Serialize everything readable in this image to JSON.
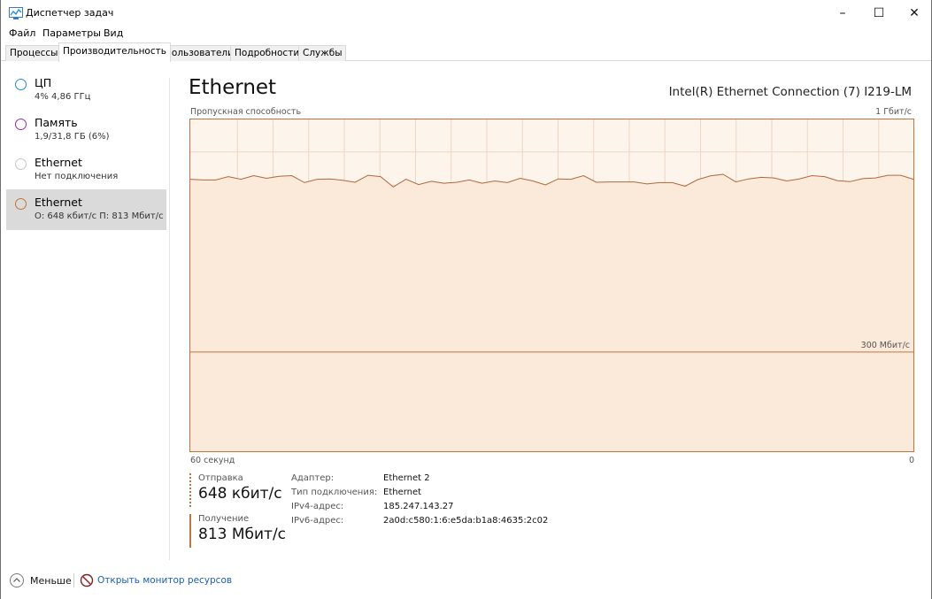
{
  "window": {
    "title": "Диспетчер задач",
    "buttons": {
      "minimize": "–",
      "maximize": "☐",
      "close": "✕"
    }
  },
  "menu": [
    "Файл",
    "Параметры",
    "Вид"
  ],
  "tabs": [
    {
      "label": "Процессы",
      "active": false
    },
    {
      "label": "Производительность",
      "active": true
    },
    {
      "label": "Пользователи",
      "active": false
    },
    {
      "label": "Подробности",
      "active": false
    },
    {
      "label": "Службы",
      "active": false
    }
  ],
  "sidebar": {
    "items": [
      {
        "name": "ЦП",
        "sub": "4% 4,86 ГГц",
        "color": "#1e8ad7",
        "selected": false
      },
      {
        "name": "Память",
        "sub": "1,9/31,8 ГБ (6%)",
        "color": "#9b2aa3",
        "selected": false
      },
      {
        "name": "Ethernet",
        "sub": "Нет подключения",
        "color": "#c8c8c8",
        "selected": false
      },
      {
        "name": "Ethernet",
        "sub": "О: 648 кбит/с П: 813 Мбит/с",
        "color": "#c1743d",
        "selected": true
      }
    ]
  },
  "main": {
    "title": "Ethernet",
    "adapter": "Intel(R) Ethernet Connection (7) I219-LM",
    "graph_label_left": "Пропускная способность",
    "graph_label_right": "1 Гбит/с",
    "scale_mark": "300 Мбит/с",
    "axis_left": "60 секунд",
    "axis_right": "0"
  },
  "stats": {
    "send_label": "Отправка",
    "send_value": "648 кбит/с",
    "recv_label": "Получение",
    "recv_value": "813 Мбит/с"
  },
  "info": [
    {
      "key": "Адаптер:",
      "value": "Ethernet 2"
    },
    {
      "key": "Тип подключения:",
      "value": "Ethernet"
    },
    {
      "key": "IPv4-адрес:",
      "value": "185.247.143.27"
    },
    {
      "key": "IPv6-адрес:",
      "value": "2a0d:c580:1:6:e5da:b1a8:4635:2c02"
    }
  ],
  "footer": {
    "less_label": "Меньше",
    "monitor_link": "Открыть монитор ресурсов"
  },
  "chart_data": {
    "type": "area",
    "ylim": [
      0,
      1000
    ],
    "yunit": "Мбит/с",
    "x_range_seconds": [
      60,
      0
    ],
    "scale_mark_value": 300,
    "series": [
      {
        "name": "Получение",
        "color": "#c1743d",
        "values": [
          818,
          816,
          816,
          826,
          818,
          829,
          821,
          827,
          829,
          808,
          818,
          819,
          815,
          809,
          830,
          826,
          795,
          818,
          802,
          812,
          806,
          809,
          816,
          806,
          813,
          808,
          821,
          813,
          801,
          819,
          818,
          829,
          809,
          810,
          810,
          810,
          804,
          808,
          808,
          797,
          817,
          828,
          833,
          810,
          819,
          824,
          822,
          813,
          819,
          829,
          826,
          814,
          811,
          820,
          822,
          830,
          830,
          818
        ]
      },
      {
        "name": "Отправка",
        "color": "#c1743d",
        "values": [
          0.65,
          0.65,
          0.65,
          0.65,
          0.65
        ]
      }
    ]
  }
}
